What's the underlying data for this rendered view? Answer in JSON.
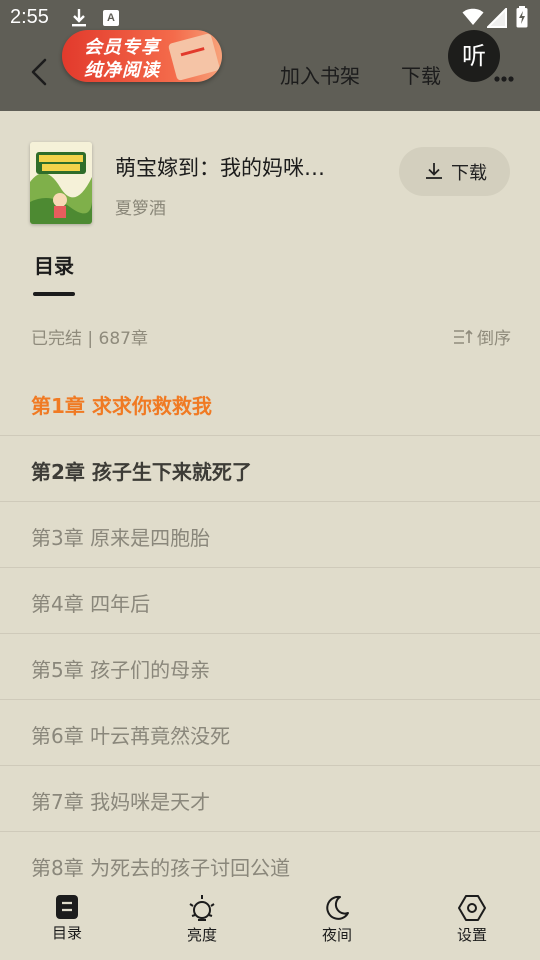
{
  "status": {
    "time": "2:55"
  },
  "header": {
    "vip_line1": "会员专享",
    "vip_line2": "纯净阅读",
    "add_shelf": "加入书架",
    "download": "下载",
    "listen": "听"
  },
  "book": {
    "title": "萌宝嫁到：我的妈咪…",
    "author": "夏箩酒",
    "download_label": "下载"
  },
  "toc": {
    "tab_label": "目录",
    "meta": "已完结 | 687章",
    "sort_label": "倒序",
    "chapters": [
      "第1章 求求你救救我",
      "第2章 孩子生下来就死了",
      "第3章 原来是四胞胎",
      "第4章 四年后",
      "第5章 孩子们的母亲",
      "第6章 叶云苒竟然没死",
      "第7章 我妈咪是天才",
      "第8章 为死去的孩子讨回公道"
    ]
  },
  "bottom_nav": {
    "toc": "目录",
    "brightness": "亮度",
    "night": "夜间",
    "settings": "设置"
  },
  "colors": {
    "background": "#e0dccb",
    "topbar": "#5f5e56",
    "current_chapter": "#f07a23",
    "vip_badge": "#e23a2c"
  }
}
